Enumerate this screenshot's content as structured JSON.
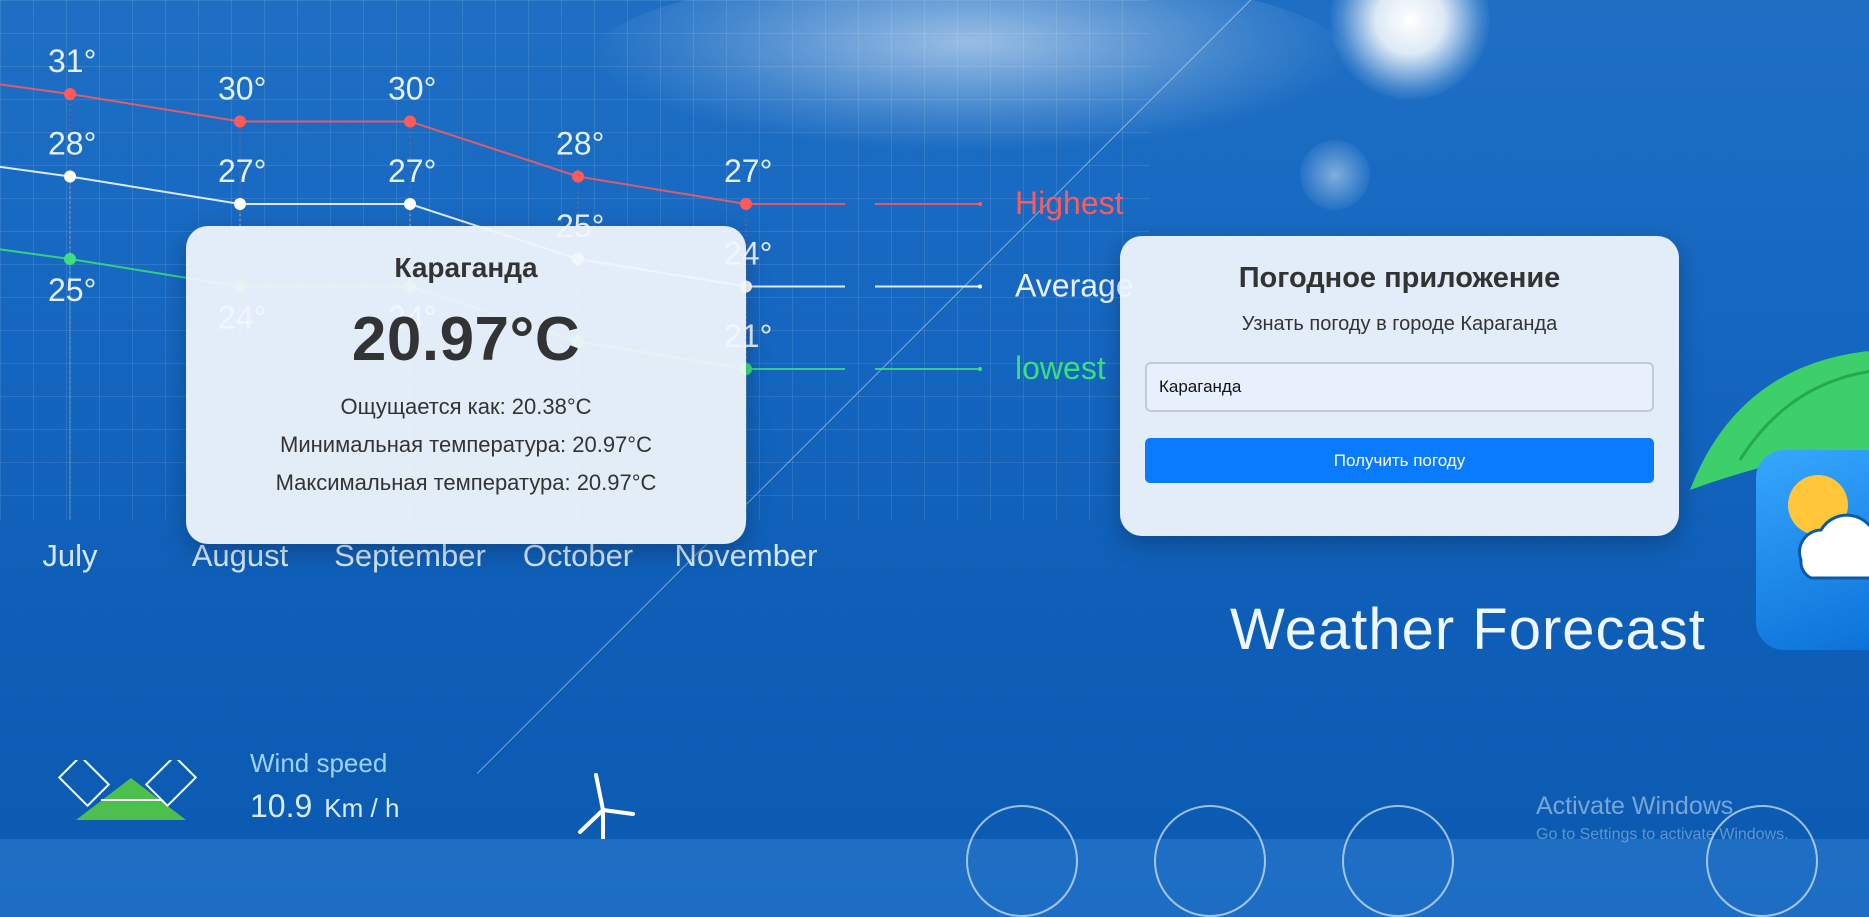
{
  "weather_card": {
    "city": "Караганда",
    "temperature": "20.97°C",
    "feels_like": "Ощущается как: 20.38°C",
    "min_temp": "Минимальная температура: 20.97°C",
    "max_temp": "Максимальная температура: 20.97°C"
  },
  "app": {
    "title": "Погодное приложение",
    "subtitle": "Узнать погоду в городе Караганда",
    "city_input_value": "Караганда",
    "submit_label": "Получить погоду"
  },
  "background": {
    "brand_title": "Weather Forecast",
    "wind_label": "Wind speed",
    "wind_value": "10.9",
    "wind_unit": "Km / h",
    "watermark": "Activate Windows",
    "watermark_sub": "Go to Settings to activate Windows."
  },
  "chart_data": {
    "type": "line",
    "categories": [
      "July",
      "August",
      "September",
      "October",
      "November"
    ],
    "series": [
      {
        "name": "Highest",
        "values": [
          31,
          30,
          30,
          28,
          27
        ],
        "labels": [
          "31°",
          "30°",
          "30°",
          "28°",
          "27°"
        ],
        "color": "#ff5a5a"
      },
      {
        "name": "Average",
        "values": [
          28,
          27,
          27,
          25,
          24
        ],
        "labels": [
          "28°",
          "27°",
          "27°",
          "25°",
          "24°"
        ],
        "color": "#ffffff"
      },
      {
        "name": "lowest",
        "values": [
          25,
          24,
          24,
          22,
          21
        ],
        "labels": [
          "25°",
          "24°",
          "24°",
          "",
          "21°"
        ],
        "color": "#3be07a"
      }
    ]
  },
  "colors": {
    "accent_button": "#0a7bff",
    "highest": "#ff5a5a",
    "lowest": "#3be07a"
  }
}
